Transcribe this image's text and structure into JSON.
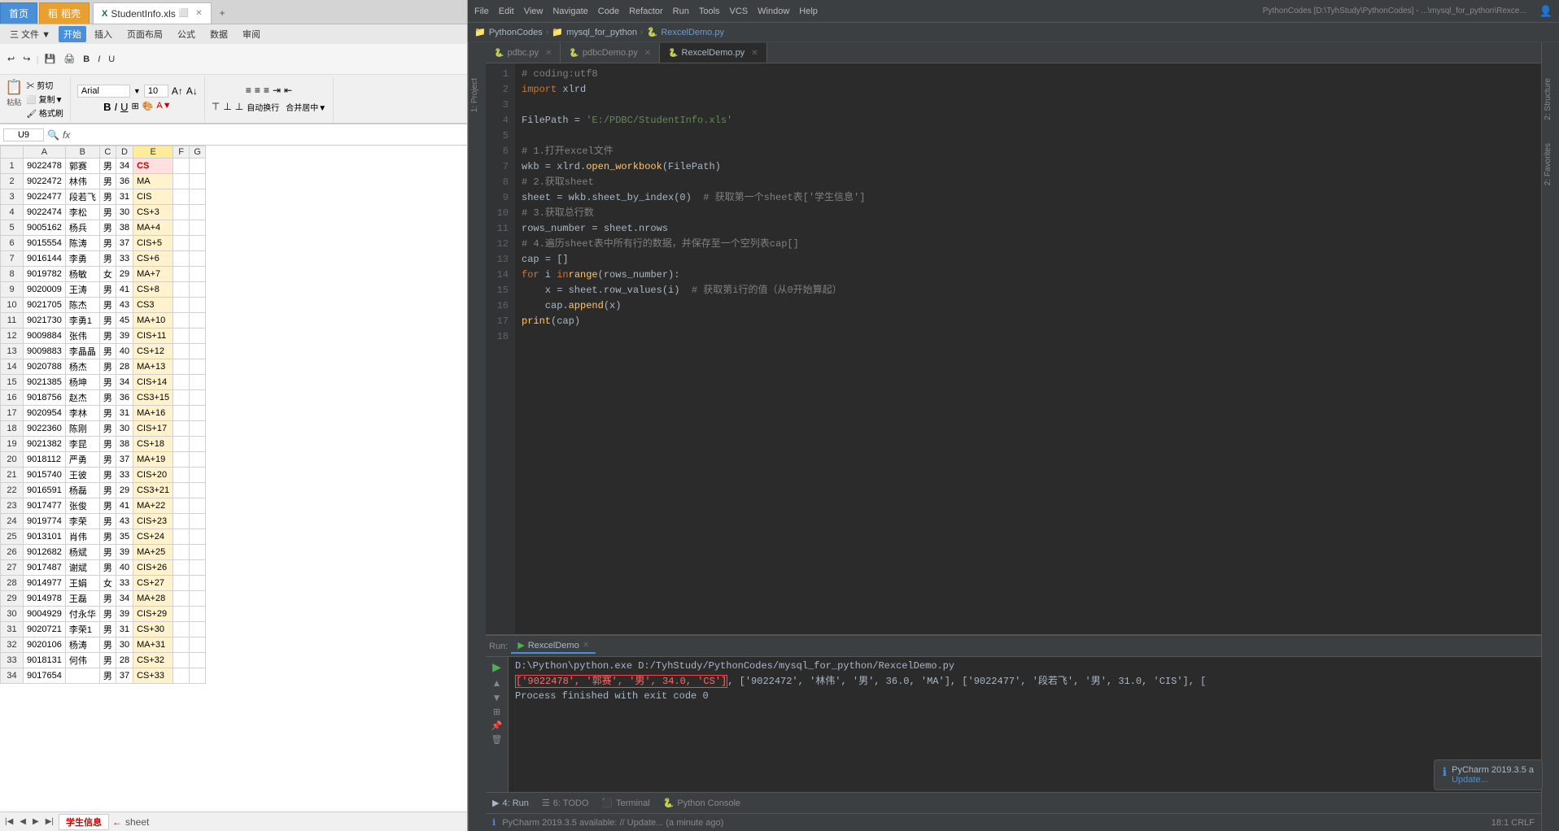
{
  "excel": {
    "tabs": [
      {
        "label": "首页",
        "type": "browser",
        "active": false
      },
      {
        "label": "稻壳",
        "type": "browser",
        "active": false
      },
      {
        "label": "StudentInfo.xls",
        "type": "excel",
        "active": true
      }
    ],
    "ribbon": {
      "tabs": [
        "三 文件▼",
        "开始",
        "插入",
        "页面布局",
        "公式",
        "数据",
        "审阅"
      ],
      "active_tab": "开始",
      "big_btn": "开始",
      "font_name": "Arial",
      "font_size": "10"
    },
    "cell_ref": "U9",
    "formula": "fx",
    "columns": [
      "A",
      "B",
      "C",
      "D",
      "E",
      "F",
      "G"
    ],
    "rows": [
      [
        "9022478",
        "郭赛",
        "男",
        "34",
        "CS",
        "",
        ""
      ],
      [
        "9022472",
        "林伟",
        "男",
        "36",
        "MA",
        "",
        ""
      ],
      [
        "9022477",
        "段若飞",
        "男",
        "31",
        "CIS",
        "",
        ""
      ],
      [
        "9022474",
        "李松",
        "男",
        "30",
        "CS+3",
        "",
        ""
      ],
      [
        "9005162",
        "杨兵",
        "男",
        "38",
        "MA+4",
        "",
        ""
      ],
      [
        "9015554",
        "陈涛",
        "男",
        "37",
        "CIS+5",
        "",
        ""
      ],
      [
        "9016144",
        "李勇",
        "男",
        "33",
        "CS+6",
        "",
        ""
      ],
      [
        "9019782",
        "杨敏",
        "女",
        "29",
        "MA+7",
        "",
        ""
      ],
      [
        "9020009",
        "王涛",
        "男",
        "41",
        "CS+8",
        "",
        ""
      ],
      [
        "9021705",
        "陈杰",
        "男",
        "43",
        "CS3",
        "",
        ""
      ],
      [
        "9021730",
        "李勇1",
        "男",
        "45",
        "MA+10",
        "",
        ""
      ],
      [
        "9009884",
        "张伟",
        "男",
        "39",
        "CIS+11",
        "",
        ""
      ],
      [
        "9009883",
        "李晶晶",
        "男",
        "40",
        "CS+12",
        "",
        ""
      ],
      [
        "9020788",
        "杨杰",
        "男",
        "28",
        "MA+13",
        "",
        ""
      ],
      [
        "9021385",
        "杨坤",
        "男",
        "34",
        "CIS+14",
        "",
        ""
      ],
      [
        "9018756",
        "赵杰",
        "男",
        "36",
        "CS3+15",
        "",
        ""
      ],
      [
        "9020954",
        "李林",
        "男",
        "31",
        "MA+16",
        "",
        ""
      ],
      [
        "9022360",
        "陈刚",
        "男",
        "30",
        "CIS+17",
        "",
        ""
      ],
      [
        "9021382",
        "李昆",
        "男",
        "38",
        "CS+18",
        "",
        ""
      ],
      [
        "9018112",
        "严勇",
        "男",
        "37",
        "MA+19",
        "",
        ""
      ],
      [
        "9015740",
        "王彼",
        "男",
        "33",
        "CIS+20",
        "",
        ""
      ],
      [
        "9016591",
        "杨磊",
        "男",
        "29",
        "CS3+21",
        "",
        ""
      ],
      [
        "9017477",
        "张俊",
        "男",
        "41",
        "MA+22",
        "",
        ""
      ],
      [
        "9019774",
        "李荣",
        "男",
        "43",
        "CIS+23",
        "",
        ""
      ],
      [
        "9013101",
        "肖伟",
        "男",
        "35",
        "CS+24",
        "",
        ""
      ],
      [
        "9012682",
        "杨斌",
        "男",
        "39",
        "MA+25",
        "",
        ""
      ],
      [
        "9017487",
        "谢斌",
        "男",
        "40",
        "CIS+26",
        "",
        ""
      ],
      [
        "9014977",
        "王娟",
        "女",
        "33",
        "CS+27",
        "",
        ""
      ],
      [
        "9014978",
        "王磊",
        "男",
        "34",
        "MA+28",
        "",
        ""
      ],
      [
        "9004929",
        "付永华",
        "男",
        "39",
        "CIS+29",
        "",
        ""
      ],
      [
        "9020721",
        "李荣1",
        "男",
        "31",
        "CS+30",
        "",
        ""
      ],
      [
        "9020106",
        "杨涛",
        "男",
        "30",
        "MA+31",
        "",
        ""
      ],
      [
        "9018131",
        "何伟",
        "男",
        "28",
        "CS+32",
        "",
        ""
      ],
      [
        "9017654",
        "",
        "男",
        "37",
        "CS+33",
        "",
        ""
      ]
    ],
    "sheet_tab": "学生信息",
    "sheet_label": "sheet"
  },
  "pycharm": {
    "title_path": "PythonCodes [D:\\TyhStudy\\PythonCodes] - ...\\mysql_for_python\\Rexce...",
    "menu_items": [
      "File",
      "Edit",
      "View",
      "Navigate",
      "Code",
      "Refactor",
      "Run",
      "Tools",
      "VCS",
      "Window",
      "Help"
    ],
    "breadcrumb": [
      "PythonCodes",
      "mysql_for_python",
      "RexcelDemo.py"
    ],
    "editor_tabs": [
      {
        "label": "pdbc.py",
        "active": false
      },
      {
        "label": "pdbcDemo.py",
        "active": false
      },
      {
        "label": "RexcelDemo.py",
        "active": true
      }
    ],
    "code_lines": [
      {
        "num": 1,
        "content": "# coding:utf8"
      },
      {
        "num": 2,
        "content": "import xlrd"
      },
      {
        "num": 3,
        "content": ""
      },
      {
        "num": 4,
        "content": "FilePath = 'E:/PDBC/StudentInfo.xls'"
      },
      {
        "num": 5,
        "content": ""
      },
      {
        "num": 6,
        "content": "# 1.打开excel文件"
      },
      {
        "num": 7,
        "content": "wkb = xlrd.open_workbook(FilePath)"
      },
      {
        "num": 8,
        "content": "# 2.获取sheet"
      },
      {
        "num": 9,
        "content": "sheet = wkb.sheet_by_index(0)  # 获取第一个sheet表['学生信息']"
      },
      {
        "num": 10,
        "content": "# 3.获取总行数"
      },
      {
        "num": 11,
        "content": "rows_number = sheet.nrows"
      },
      {
        "num": 12,
        "content": "# 4.遍历sheet表中所有行的数据，并保存至一个空列表cap[]"
      },
      {
        "num": 13,
        "content": "cap = []"
      },
      {
        "num": 14,
        "content": "for i in range(rows_number):"
      },
      {
        "num": 15,
        "content": "    x = sheet.row_values(i)  # 获取第i行的值（从0开始算起）"
      },
      {
        "num": 16,
        "content": "    cap.append(x)"
      },
      {
        "num": 17,
        "content": "print(cap)"
      },
      {
        "num": 18,
        "content": ""
      }
    ],
    "run": {
      "tab_label": "RexcelDemo",
      "command": "D:\\Python\\python.exe D:/TyhStudy/PythonCodes/mysql_for_python/RexcelDemo.py",
      "output_highlight": "['9022478', '郭赛', '男', 34.0, 'CS']",
      "output_rest": ", ['9022472', '林伟', '男', 36.0, 'MA'], ['9022477', '段若飞', '男', 31.0, 'CIS'], [",
      "output_success": "Process finished with exit code 0"
    },
    "bottom_tabs": [
      "▶ 4: Run",
      "☰ 6: TODO",
      "⬛ Terminal",
      "🐍 Python Console"
    ],
    "status": "PyCharm 2019.3.5 available: // Update... (a minute ago)",
    "status_right": "18:1  CRLF",
    "notification": {
      "title": "PyCharm 2019.3.5 a",
      "body": "Update..."
    },
    "vert_tabs": [
      "1: Project",
      "2: Structure",
      "2: Favorites"
    ]
  }
}
